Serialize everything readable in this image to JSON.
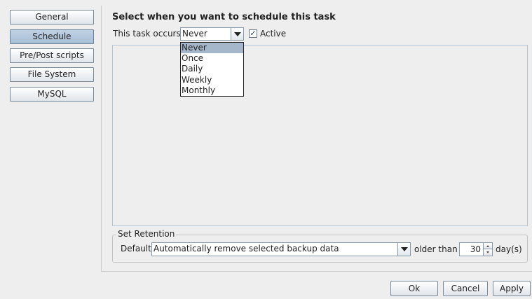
{
  "nav": {
    "items": [
      {
        "label": "General",
        "selected": false
      },
      {
        "label": "Schedule",
        "selected": true
      },
      {
        "label": "Pre/Post scripts",
        "selected": false
      },
      {
        "label": "File System",
        "selected": false
      },
      {
        "label": "MySQL",
        "selected": false
      }
    ]
  },
  "schedule": {
    "heading": "Select when you want to schedule this task",
    "occurs_label": "This task occurs",
    "occurs_value": "Never",
    "active_label": "Active",
    "active_checked": true,
    "dropdown_options": [
      "Never",
      "Once",
      "Daily",
      "Weekly",
      "Monthly"
    ],
    "dropdown_selected": "Never"
  },
  "retention": {
    "legend": "Set Retention",
    "default_label": "Default",
    "policy_value": "Automatically remove selected backup data",
    "older_than_label": "older than",
    "days_value": "30",
    "days_unit": "day(s)"
  },
  "actions": {
    "ok_label": "Ok",
    "cancel_label": "Cancel",
    "apply_label": "Apply"
  },
  "colors": {
    "selected_nav": "#a8bfd8",
    "dropdown_highlight": "#a5b7cb"
  }
}
